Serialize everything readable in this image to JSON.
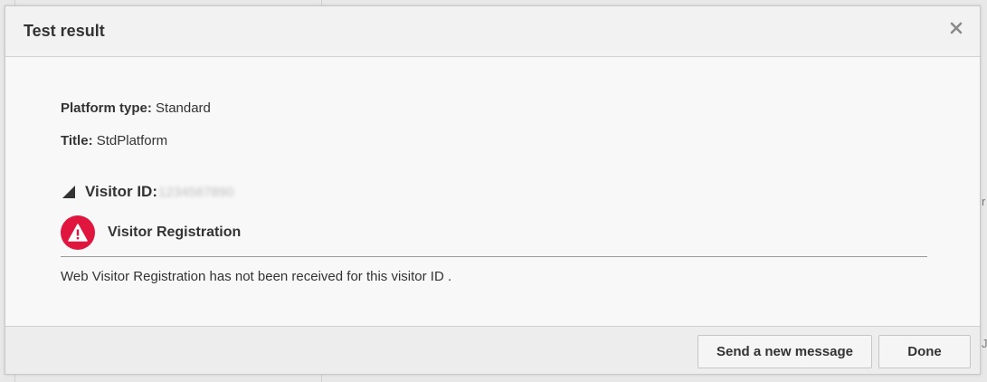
{
  "dialog": {
    "title": "Test result",
    "close_icon": "close-icon"
  },
  "fields": {
    "platform_type_label": "Platform type:",
    "platform_type_value": "Standard",
    "title_label": "Title:",
    "title_value": "StdPlatform"
  },
  "visitor": {
    "label": "Visitor ID:",
    "id_value": "1234567890",
    "toggle_icon": "collapse-triangle-icon"
  },
  "registration": {
    "status_icon": "warning-icon",
    "status_color": "#e0163e",
    "label": "Visitor Registration",
    "message": "Web Visitor Registration has not been received for this visitor ID ."
  },
  "footer": {
    "send_label": "Send a new message",
    "done_label": "Done"
  },
  "background": {
    "hint_1": "r",
    "hint_2": "J"
  }
}
